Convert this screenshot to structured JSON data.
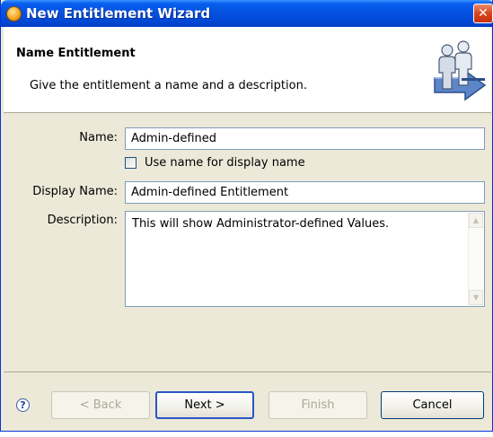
{
  "window": {
    "title": "New Entitlement Wizard",
    "close_glyph": "✕",
    "app_icon": "wizard-orb-icon"
  },
  "header": {
    "title": "Name Entitlement",
    "description": "Give the entitlement a name and a description.",
    "icon": "entitlement-users-icon"
  },
  "form": {
    "name_label": "Name:",
    "name_value": "Admin-defined",
    "use_name_checkbox_label": "Use name for display name",
    "use_name_checked": false,
    "display_name_label": "Display Name:",
    "display_name_value": "Admin-defined Entitlement",
    "description_label": "Description:",
    "description_value": "This will show Administrator-defined Values."
  },
  "buttons": {
    "help_glyph": "?",
    "back": "< Back",
    "next": "Next >",
    "finish": "Finish",
    "cancel": "Cancel"
  },
  "colors": {
    "titlebar": "#0552e0",
    "dialog_bg": "#ece9d8",
    "button_border": "#003c74",
    "default_button_border": "#2a56c4"
  }
}
